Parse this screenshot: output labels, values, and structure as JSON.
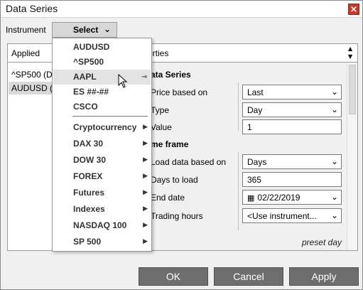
{
  "window": {
    "title": "Data Series",
    "close_icon": "×"
  },
  "instrument": {
    "label": "Instrument",
    "select_label": "Select",
    "chevron": "⌄"
  },
  "applied": {
    "header": "Applied",
    "items": [
      "^SP500 (D",
      "AUDUSD ("
    ]
  },
  "properties": {
    "header": "erties",
    "section_data_series": "ata Series",
    "price_based_on_label": "Price based on",
    "price_based_on_value": "Last",
    "type_label": "Type",
    "type_value": "Day",
    "value_label": "Value",
    "value_value": "1",
    "section_time_frame": "me frame",
    "load_based_on_label": "Load data based on",
    "load_based_on_value": "Days",
    "days_to_load_label": "Days to load",
    "days_to_load_value": "365",
    "end_date_label": "End date",
    "end_date_value": "02/22/2019",
    "trading_hours_label": "Trading hours",
    "trading_hours_value": "<Use instrument...",
    "preset_text": "preset day"
  },
  "dropdown": {
    "recent": [
      "AUDUSD",
      "^SP500",
      "AAPL",
      "ES ##-##",
      "CSCO"
    ],
    "groups": [
      "Cryptocurrency",
      "DAX 30",
      "DOW 30",
      "FOREX",
      "Futures",
      "Indexes",
      "NASDAQ 100",
      "SP 500"
    ],
    "hovered": "AAPL"
  },
  "buttons": {
    "ok": "OK",
    "cancel": "Cancel",
    "apply": "Apply"
  },
  "colors": {
    "button_bg": "#6e6e6e",
    "close_bg": "#c0392b",
    "hover_bg": "#e3e3e3"
  }
}
